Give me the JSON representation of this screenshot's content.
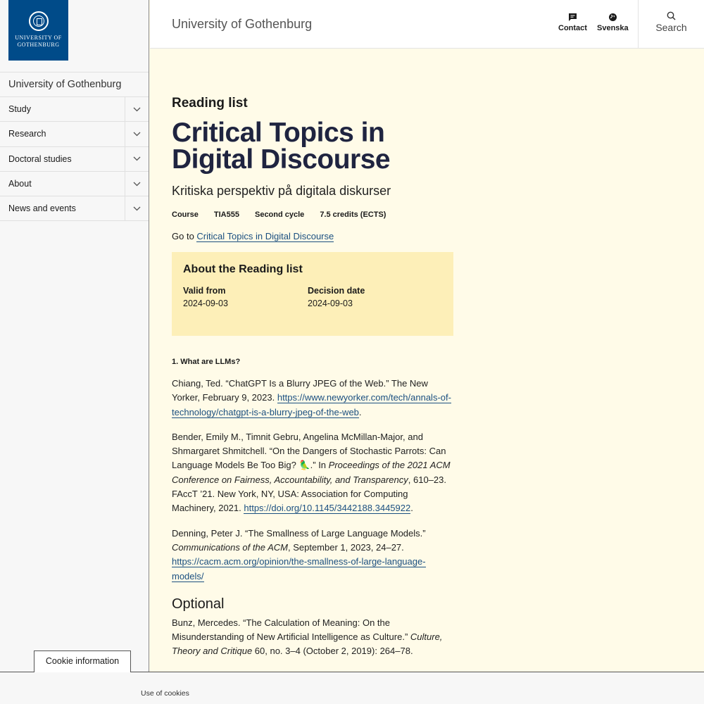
{
  "logo": {
    "line1": "UNIVERSITY OF",
    "line2": "GOTHENBURG"
  },
  "sidebar": {
    "title": "University of Gothenburg",
    "items": [
      {
        "label": "Study"
      },
      {
        "label": "Research"
      },
      {
        "label": "Doctoral studies"
      },
      {
        "label": "About"
      },
      {
        "label": "News and events"
      }
    ]
  },
  "header": {
    "brand": "University of Gothenburg",
    "contact": "Contact",
    "language": "Svenska",
    "search": "Search"
  },
  "page": {
    "kicker": "Reading list",
    "title": "Critical Topics in Digital Discourse",
    "subtitle": "Kritiska perspektiv på digitala diskurser",
    "meta": [
      "Course",
      "TIA555",
      "Second cycle",
      "7.5 credits (ECTS)"
    ],
    "goto_prefix": "Go to",
    "goto_link": "Critical Topics in Digital Discourse",
    "about": {
      "heading": "About the Reading list",
      "valid_from_label": "Valid from",
      "valid_from": "2024-09-03",
      "decision_label": "Decision date",
      "decision": "2024-09-03"
    },
    "section1": "1. What are LLMs?",
    "refs": {
      "r1_text": "Chiang, Ted. “ChatGPT Is a Blurry JPEG of the Web.” The New Yorker, February 9, 2023. ",
      "r1_link": "https://www.newyorker.com/tech/annals-of-technology/chatgpt-is-a-blurry-jpeg-of-the-web",
      "r2_text": "Bender, Emily M., Timnit Gebru, Angelina McMillan-Major, and Shmargaret Shmitchell. “On the Dangers of Stochastic Parrots: Can Language Models Be Too Big? 🦜.” In ",
      "r2_italic": "Proceedings of the 2021 ACM Conference on Fairness, Accountability, and Transparency",
      "r2_rest": ", 610–23. FAccT ’21. New York, NY, USA: Association for Computing Machinery, 2021. ",
      "r2_link": "https://doi.org/10.1145/3442188.3445922",
      "r3_text": "Denning, Peter J. “The Smallness of Large Language Models.” ",
      "r3_italic": "Communications of the ACM",
      "r3_rest": ", September 1, 2023, 24–27. ",
      "r3_link": "https://cacm.acm.org/opinion/the-smallness-of-large-language-models/",
      "optional_heading": "Optional",
      "r4_text": "Bunz, Mercedes. “The Calculation of Meaning: On the Misunderstanding of New Artificial Intelligence as Culture.” ",
      "r4_italic": "Culture, Theory and Critique",
      "r4_rest": " 60, no. 3–4 (October 2, 2019): 264–78."
    }
  },
  "cookie": {
    "tab": "Cookie information",
    "use": "Use of cookies"
  }
}
